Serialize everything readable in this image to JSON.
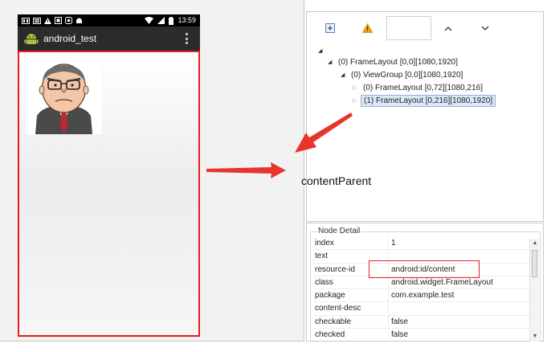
{
  "device": {
    "status_time": "13:59",
    "app_title": "android_test"
  },
  "hierarchy": {
    "nodes": [
      {
        "label": "(0) FrameLayout [0,0][1080,1920]"
      },
      {
        "label": "(0) ViewGroup [0,0][1080,1920]"
      },
      {
        "label": "(0) FrameLayout [0,72][1080,216]"
      },
      {
        "label": "(1) FrameLayout [0,216][1080,1920]"
      }
    ]
  },
  "node_detail": {
    "title": "Node Detail",
    "rows": [
      {
        "key": "index",
        "value": "1"
      },
      {
        "key": "text",
        "value": ""
      },
      {
        "key": "resource-id",
        "value": "android:id/content"
      },
      {
        "key": "class",
        "value": "android.widget.FrameLayout"
      },
      {
        "key": "package",
        "value": "com.example.test"
      },
      {
        "key": "content-desc",
        "value": ""
      },
      {
        "key": "checkable",
        "value": "false"
      },
      {
        "key": "checked",
        "value": "false"
      }
    ]
  },
  "annotation": {
    "label": "contentParent",
    "color": "#e02020"
  },
  "icons": {
    "expand": "expand-all-icon",
    "warning": "warning-icon",
    "prev": "chevron-up-icon",
    "next": "chevron-down-icon"
  }
}
